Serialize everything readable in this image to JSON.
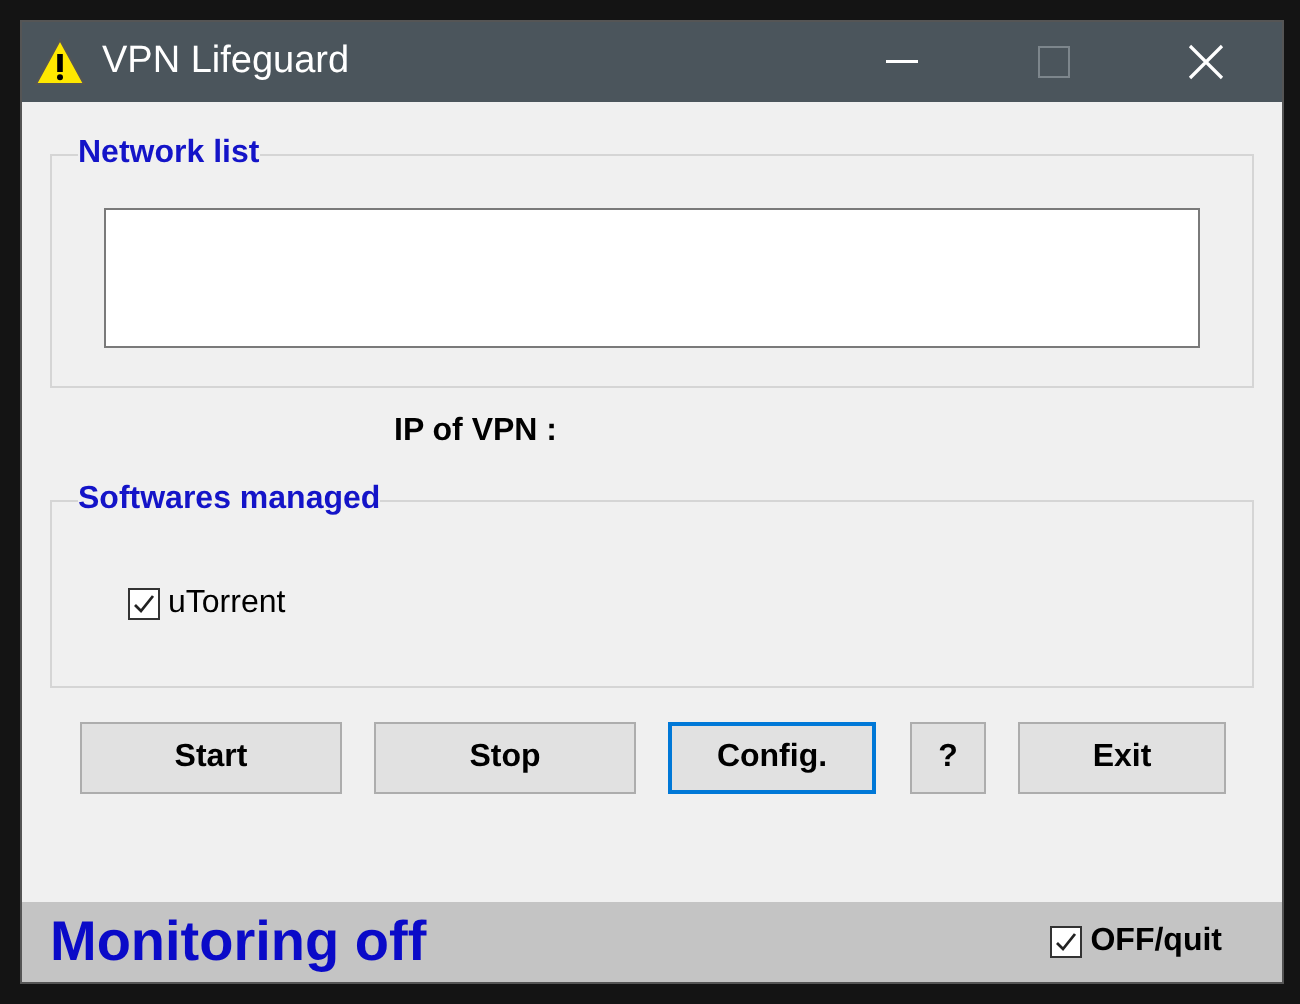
{
  "window": {
    "title": "VPN Lifeguard"
  },
  "network_list": {
    "title": "Network list"
  },
  "ip_label": "IP of VPN :",
  "softwares": {
    "title": "Softwares managed",
    "items": [
      {
        "label": "uTorrent",
        "checked": true
      }
    ]
  },
  "buttons": [
    {
      "label": "Start",
      "focused": false
    },
    {
      "label": "Stop",
      "focused": false
    },
    {
      "label": "Config.",
      "focused": true
    },
    {
      "label": "?",
      "focused": false
    },
    {
      "label": "Exit",
      "focused": false
    }
  ],
  "status_bar": {
    "text": "Monitoring off",
    "option": {
      "label": "OFF/quit",
      "checked": true
    }
  }
}
